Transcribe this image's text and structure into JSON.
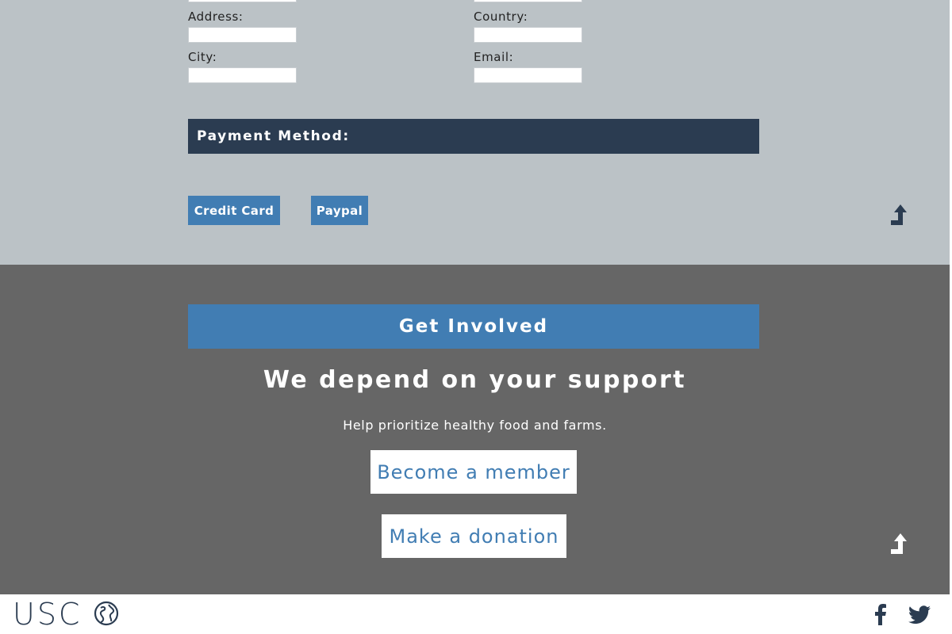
{
  "form": {
    "left_fields": [
      {
        "label": "Address:",
        "value": ""
      },
      {
        "label": "City:",
        "value": ""
      }
    ],
    "right_fields": [
      {
        "label": "Country:",
        "value": ""
      },
      {
        "label": "Email:",
        "value": ""
      }
    ],
    "payment_heading": "Payment Method:",
    "credit_card_label": "Credit Card",
    "paypal_label": "Paypal"
  },
  "involve": {
    "banner": "Get Involved",
    "heading": "We depend on your support",
    "subheading": "Help prioritize healthy food and farms.",
    "member_label": "Become a member",
    "donation_label": "Make a donation"
  },
  "footer": {
    "logo_text": "USC",
    "icons": [
      "globe-icon",
      "facebook-icon",
      "twitter-icon"
    ]
  },
  "colors": {
    "form_bg": "#bbc2c6",
    "payment_bar": "#2b3c51",
    "accent_blue": "#417db3",
    "involve_bg": "#666666",
    "footer_bg": "#ffffff"
  }
}
